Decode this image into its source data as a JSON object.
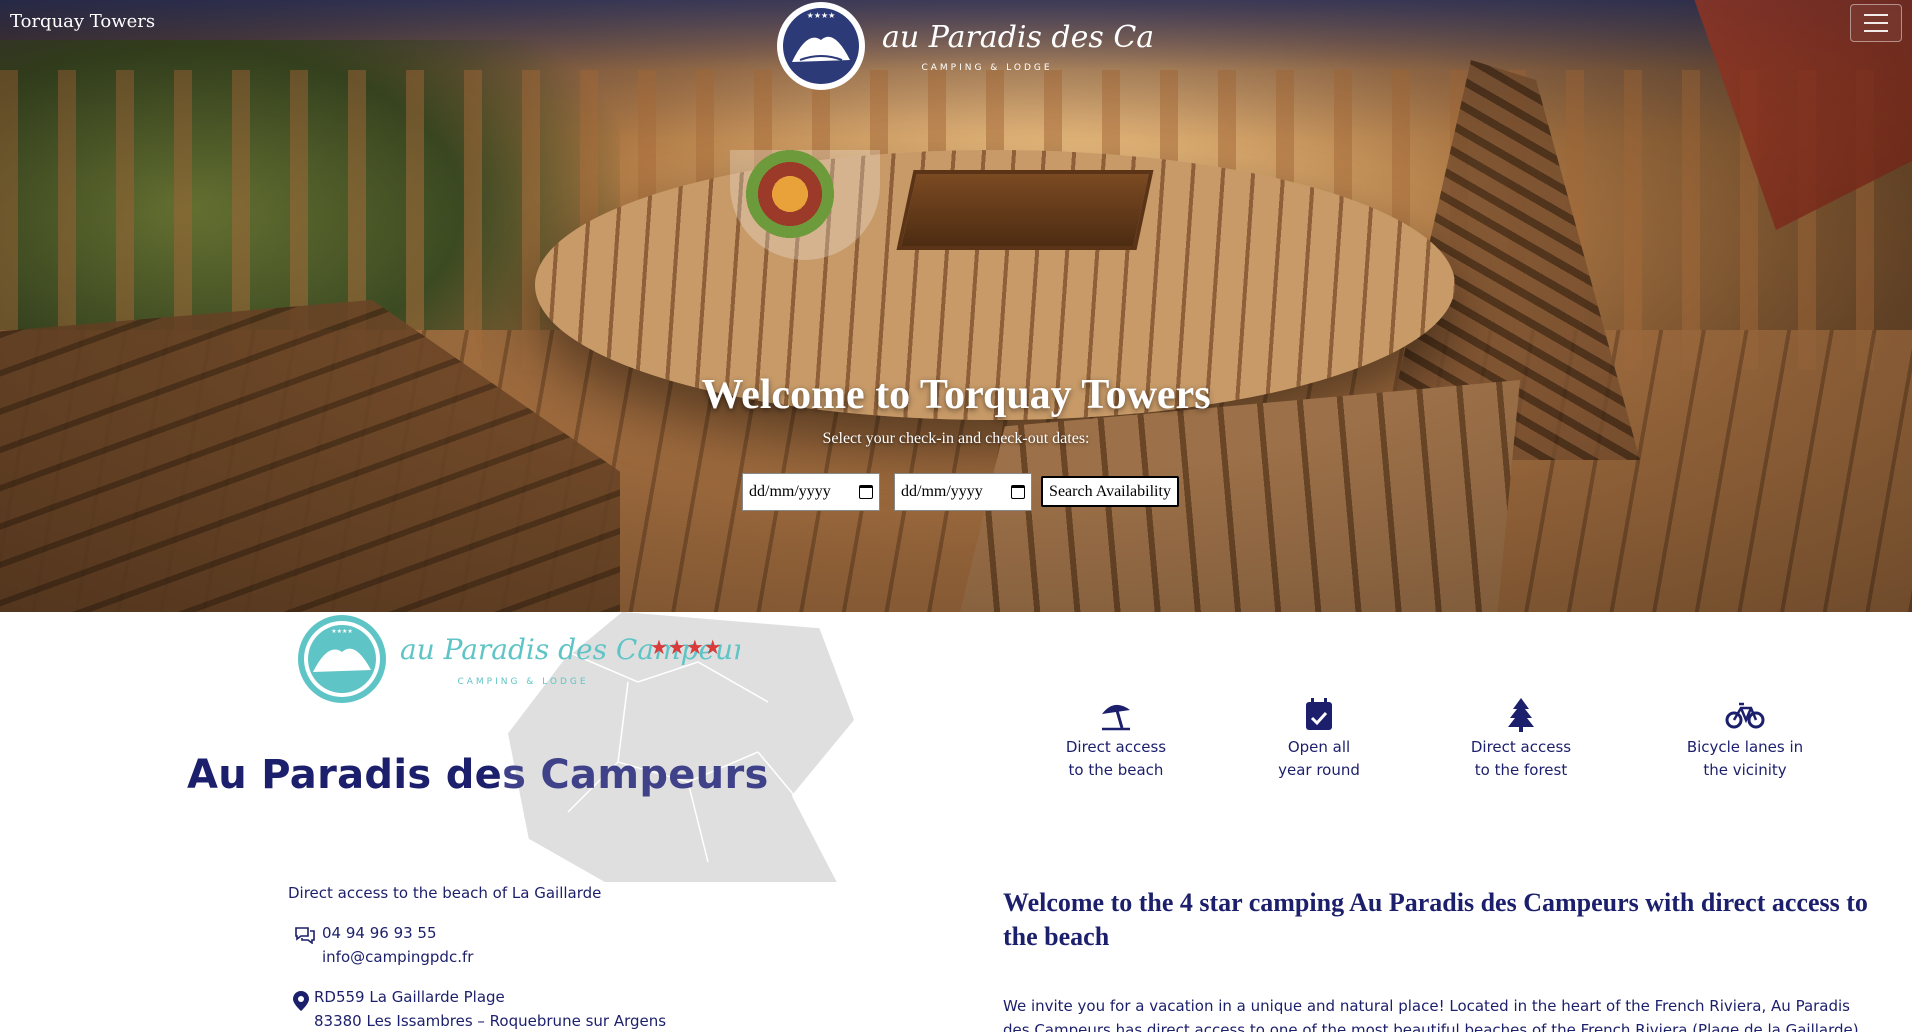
{
  "header": {
    "brand_name": "Torquay Towers",
    "logo": {
      "script_text": "au Paradis des Campeurs",
      "tagline": "CAMPING & LODGE",
      "stars": "★★★★"
    },
    "menu_icon": "hamburger-icon"
  },
  "hero": {
    "title": "Welcome to Torquay Towers",
    "subtitle": "Select your check-in and check-out dates:",
    "checkin_placeholder": "dd/mm/yyyy",
    "checkout_placeholder": "dd/mm/yyyy",
    "search_button": "Search Availability"
  },
  "intro": {
    "logo_script": "au Paradis des Campeurs",
    "logo_tagline": "CAMPING & LODGE",
    "logo_stars": "★★★★",
    "title_part1": "Au Paradis de",
    "title_part2": "s Campeurs"
  },
  "features": [
    {
      "icon": "beach-umbrella-icon",
      "line1": "Direct access",
      "line2": "to the beach"
    },
    {
      "icon": "calendar-check-icon",
      "line1": "Open all",
      "line2": "year round"
    },
    {
      "icon": "tree-icon",
      "line1": "Direct access",
      "line2": "to the forest"
    },
    {
      "icon": "bicycle-icon",
      "line1": "Bicycle lanes in",
      "line2": "the vicinity"
    }
  ],
  "contact": {
    "beach_access": "Direct access to the beach of La Gaillarde",
    "phone": "04 94 96 93 55",
    "email": "info@campingpdc.fr",
    "address_line1": "RD559 La Gaillarde Plage",
    "address_line2": "83380 Les Issambres – Roquebrune sur Argens"
  },
  "welcome": {
    "heading": "Welcome to the 4 star camping Au Paradis des Campeurs with direct access to the beach",
    "text": "We invite you for a vacation in a unique and natural place! Located in the heart of the French Riviera, Au Paradis des Campeurs has direct access to one of the most beautiful beaches of the French Riviera (Plage de la Gaillarde) and the"
  },
  "colors": {
    "navy": "#1c1f6b",
    "teal": "#5fc4c6",
    "star_red": "#d93a3a",
    "header_overlay": "#28346e"
  }
}
